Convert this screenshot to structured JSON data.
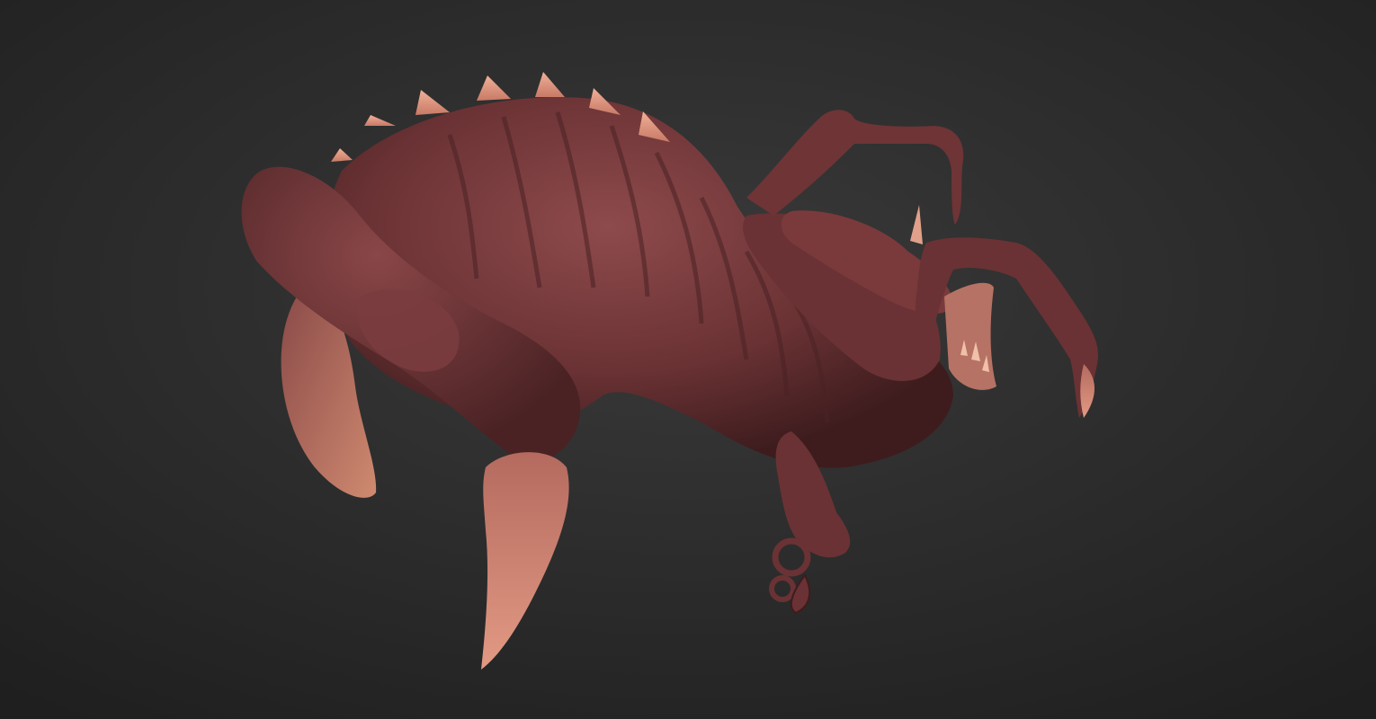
{
  "colors": {
    "background_center": "#3a3a3a",
    "background_edge": "#1f1f1f",
    "skin_dark": "#5a2a2c",
    "skin_mid": "#7a3a3c",
    "skin_light": "#9a5050",
    "claw": "#d98a78",
    "spike": "#e8a08a",
    "belly": "#c07a68"
  },
  "scene": {
    "subject": "creature-sculpt"
  }
}
